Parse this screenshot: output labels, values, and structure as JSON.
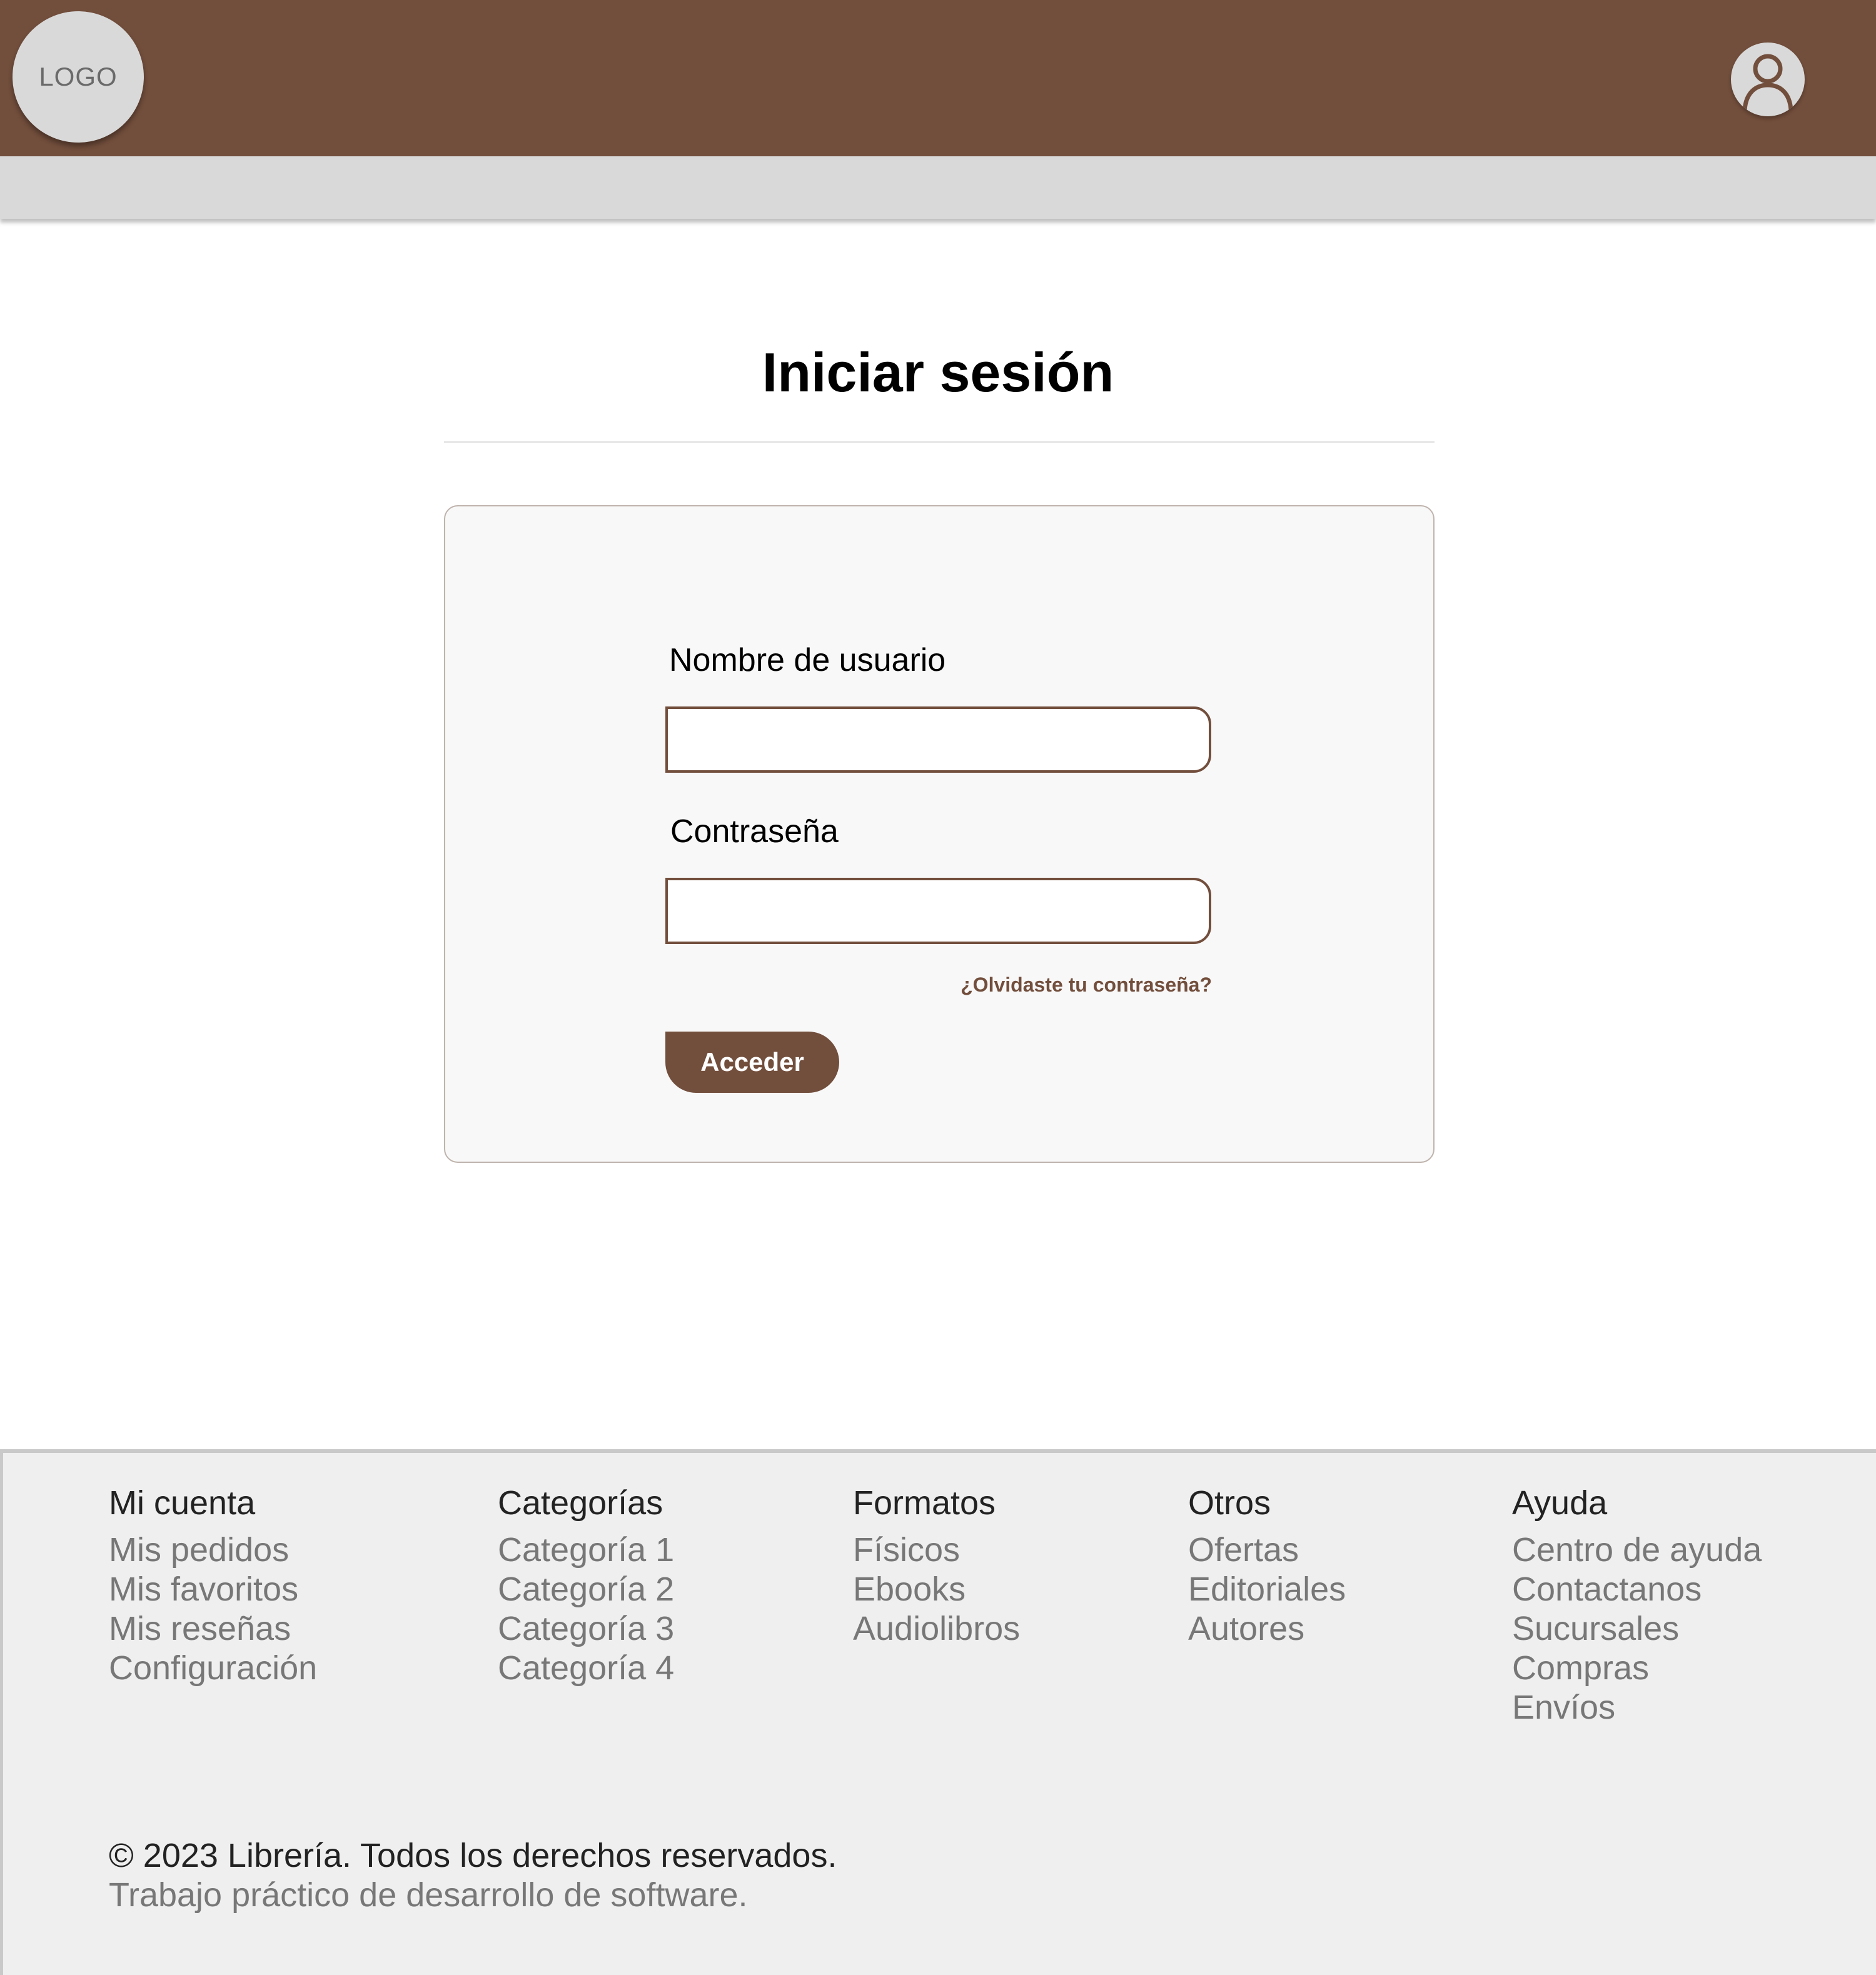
{
  "header": {
    "logo_text": "LOGO",
    "bar_color": "#724e3c",
    "user_icon": "user-icon"
  },
  "main": {
    "title": "Iniciar sesión",
    "username_label": "Nombre de usuario",
    "username_value": "",
    "password_label": "Contraseña",
    "password_value": "",
    "forgot_link": "¿Olvidaste tu contraseña?",
    "submit_label": "Acceder"
  },
  "footer": {
    "columns": [
      {
        "title": "Mi cuenta",
        "links": [
          "Mis pedidos",
          "Mis favoritos",
          "Mis reseñas",
          "Configuración"
        ]
      },
      {
        "title": "Categorías",
        "links": [
          "Categoría 1",
          "Categoría 2",
          "Categoría 3",
          "Categoría 4"
        ]
      },
      {
        "title": "Formatos",
        "links": [
          "Físicos",
          "Ebooks",
          "Audiolibros"
        ]
      },
      {
        "title": "Otros",
        "links": [
          "Ofertas",
          "Editoriales",
          "Autores"
        ]
      },
      {
        "title": "Ayuda",
        "links": [
          "Centro de ayuda",
          "Contactanos",
          "Sucursales",
          "Compras",
          "Envíos"
        ]
      }
    ],
    "copyright": "© 2023 Librería. Todos los derechos reservados.",
    "subtitle": "Trabajo práctico de desarrollo de software."
  }
}
